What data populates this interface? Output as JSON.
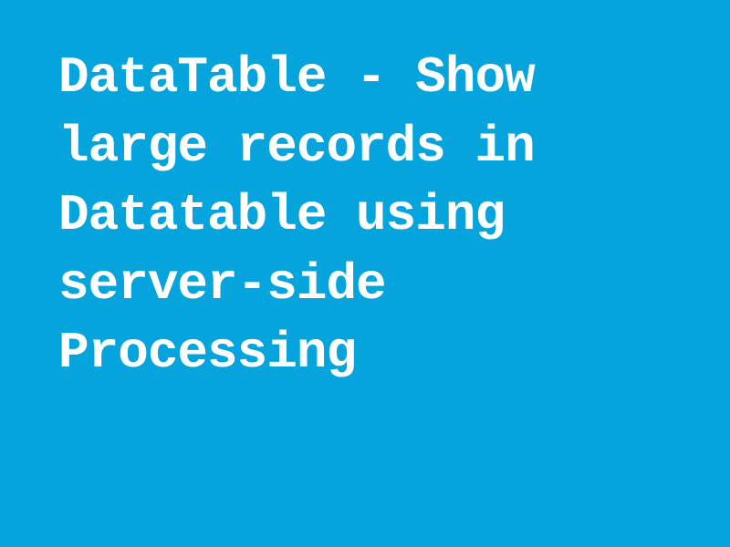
{
  "title": "DataTable -  Show large records in Datatable using server-side Processing",
  "colors": {
    "background": "#05a4dc",
    "text": "#ffffff"
  }
}
